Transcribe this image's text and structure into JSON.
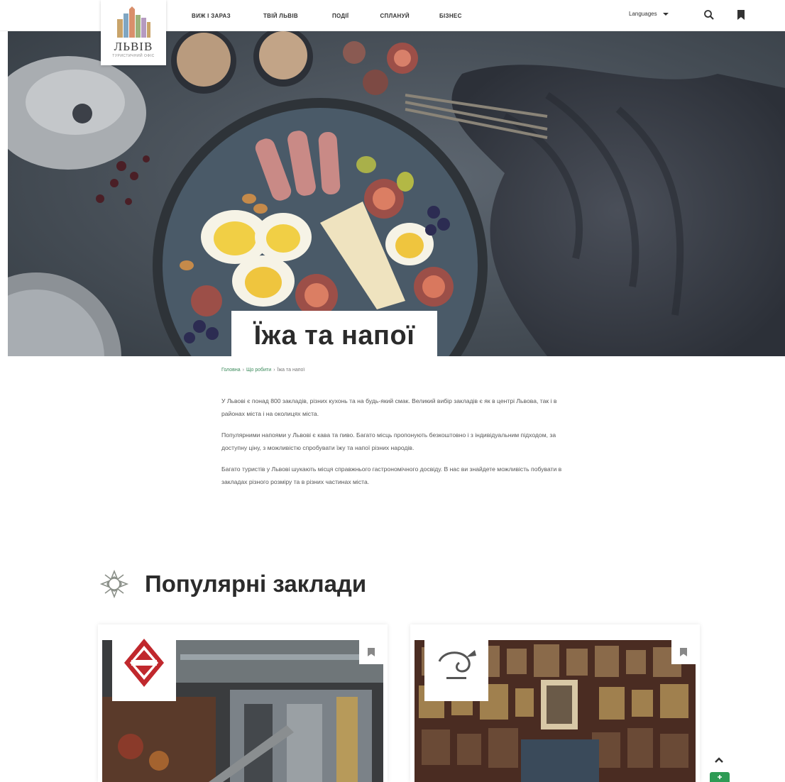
{
  "site": {
    "logo_text": "ЛЬВІВ",
    "logo_sub": "ТУРИСТИЧНИЙ ОФІС"
  },
  "nav": {
    "items": [
      {
        "label": "ВИЖ І ЗАРАЗ"
      },
      {
        "label": "ТВІЙ ЛЬВІВ"
      },
      {
        "label": "ПОДІЇ"
      },
      {
        "label": "СПЛАНУЙ"
      },
      {
        "label": "БІЗНЕС"
      }
    ],
    "language_label": "Languages"
  },
  "hero": {
    "title": "Їжа та напої"
  },
  "breadcrumb": {
    "home": "Головна",
    "parent": "Що робити",
    "current": "Їжа та напої"
  },
  "article": {
    "paragraphs": [
      "У Львові є понад 800 закладів, різних кухонь та на будь-який смак. Великий вибір закладів є як в центрі Львова, так і в районах міста і на околицях міста.",
      "Популярними напоями у Львові є кава та пиво. Багато місць пропонують безкоштовно і з індивідуальним підходом, за доступну ціну, з можливістю спробувати їжу та напої різних народів.",
      "Багато туристів у Львові шукають місця справжнього гастрономічного досвіду. В нас ви знайдете можливість побувати в закладах різного розміру та в різних частинах міста."
    ]
  },
  "popular": {
    "title": "Популярні заклади"
  },
  "colors": {
    "accent_green": "#2e9b55",
    "text_dark": "#2b2b2b"
  }
}
